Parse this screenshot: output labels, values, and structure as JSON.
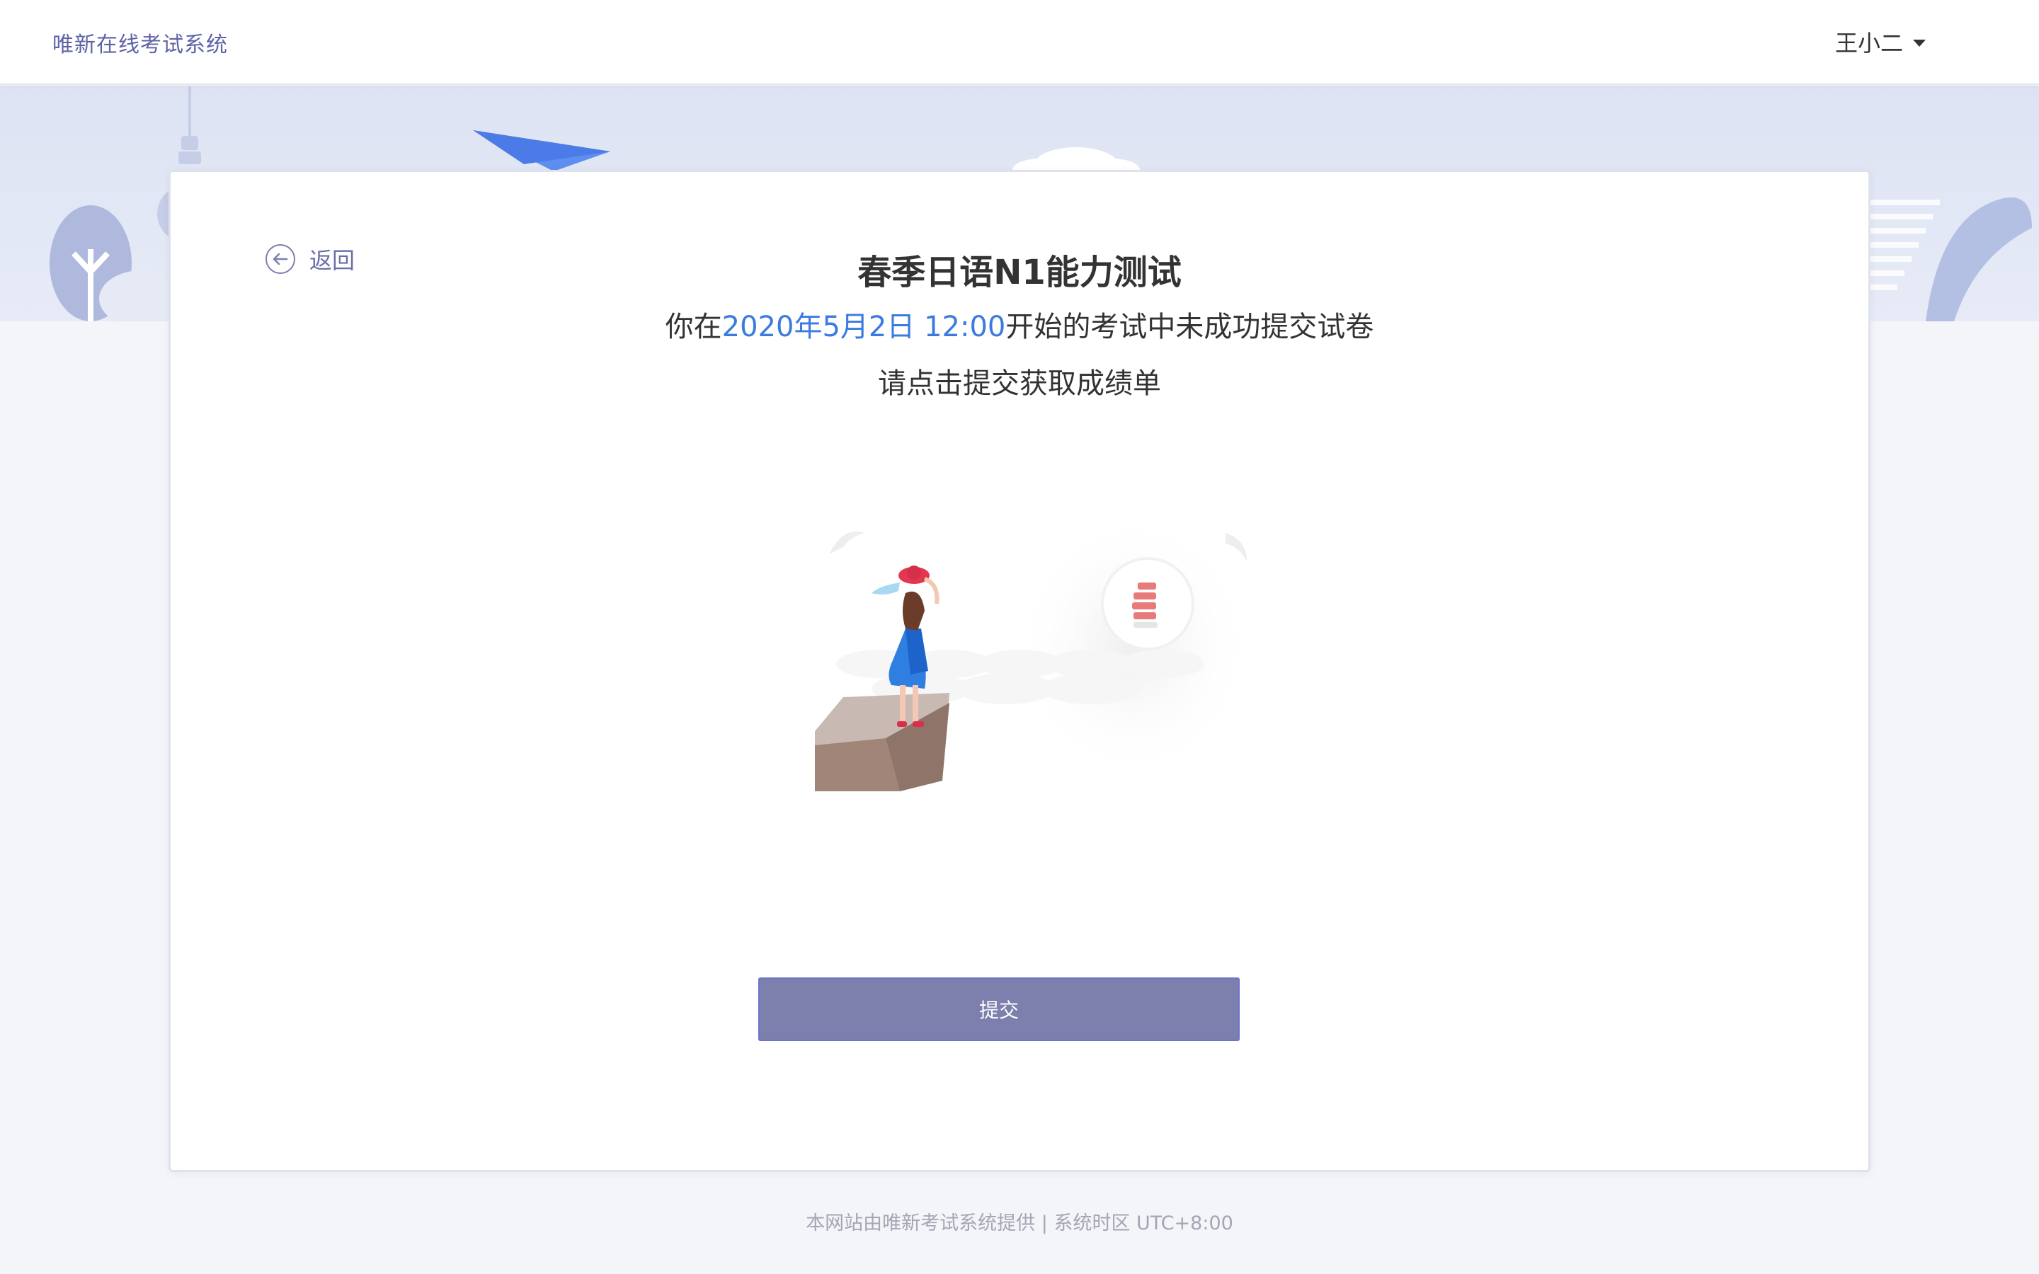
{
  "header": {
    "brand": "唯新在线考试系统",
    "user_name": "王小二"
  },
  "card": {
    "back_label": "返回",
    "exam_title": "春季日语N1能力测试",
    "message_prefix": "你在",
    "message_time": "2020年5月2日 12:00",
    "message_suffix": "开始的考试中未成功提交试卷",
    "instruction": "请点击提交获取成绩单",
    "submit_label": "提交"
  },
  "footer": {
    "text": "本网站由唯新考试系统提供 | 系统时区 UTC+8:00"
  },
  "colors": {
    "brand": "#5e63a6",
    "highlight": "#3b7be0",
    "button": "#7d7fad",
    "page_bg": "#f4f5f9"
  },
  "icons": [
    "caret-down-icon",
    "back-arrow-icon"
  ]
}
